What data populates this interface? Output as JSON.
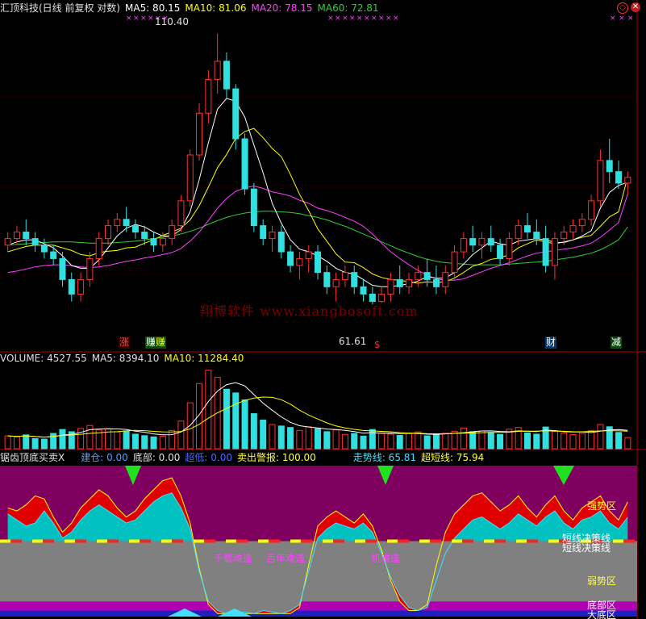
{
  "panel1": {
    "title": "汇顶科技(日线 前复权 对数)",
    "ma5_label": "MA5: 80.15",
    "ma10_label": "MA10: 81.06",
    "ma20_label": "MA20: 78.15",
    "ma60_label": "MA60: 72.81",
    "high_marker": "110.40",
    "low_marker": "61.61",
    "watermark": "翔博软件 www.xiangbosoft.com",
    "signals": [
      {
        "text": "涨",
        "color": "#ff4040",
        "bg": "#3a0000"
      },
      {
        "text": "赚",
        "color": "#ffffff",
        "bg": "#0a4a0a"
      },
      {
        "text": "赚",
        "color": "#ffff00",
        "bg": "#0a4a0a"
      },
      {
        "text": "$",
        "color": "#ff2020",
        "bg": "#000000"
      },
      {
        "text": "财",
        "color": "#ffffff",
        "bg": "#003a6a"
      },
      {
        "text": "减",
        "color": "#ffffff",
        "bg": "#0a4a0a"
      }
    ],
    "controls": [
      "◇",
      "✕"
    ]
  },
  "panel2": {
    "volume_label": "VOLUME: 4527.55",
    "ma5_label": "MA5: 8394.10",
    "ma10_label": "MA10: 11284.40"
  },
  "panel3": {
    "title": "锯齿顶底买卖X",
    "items": [
      {
        "label": "建仓: 0.00",
        "color": "#4aa0ff"
      },
      {
        "label": "底部: 0.00",
        "color": "#e0e0e0"
      },
      {
        "label": "超低: 0.00",
        "color": "#4a6aff"
      },
      {
        "label": "卖出警报: 100.00",
        "color": "#ffff40"
      },
      {
        "label": "走势线: 65.81",
        "color": "#40e0ff"
      },
      {
        "label": "超短线: 75.94",
        "color": "#ffff40"
      }
    ],
    "zone_labels": {
      "strong": "强势区",
      "decision1": "短线决策线",
      "decision2": "短线决策线",
      "weak": "弱势区",
      "bottom": "底部区",
      "big_bottom": "大底区"
    },
    "annotations": [
      "千载难逢",
      "百年难逢",
      "机难逢"
    ]
  },
  "colors": {
    "up": "#ff3030",
    "down": "#30e0e0",
    "ma5": "#ffffff",
    "ma10": "#ffff00",
    "ma20": "#ff40ff",
    "ma60": "#30d030",
    "strong_bg": "#800060",
    "weak_bg": "#808080",
    "trend": "#00c0c0"
  },
  "chart_data": {
    "type": "candlestick",
    "price_scale": "log",
    "ylim": [
      58,
      115
    ],
    "candles": [
      [
        70,
        72,
        69,
        71
      ],
      [
        71,
        73,
        70,
        72
      ],
      [
        72,
        74,
        70,
        71
      ],
      [
        71,
        72,
        69,
        70
      ],
      [
        70,
        71,
        68,
        69
      ],
      [
        69,
        70,
        67,
        68
      ],
      [
        68,
        69,
        64,
        65
      ],
      [
        65,
        66,
        62,
        63
      ],
      [
        63,
        66,
        62,
        65
      ],
      [
        65,
        69,
        64,
        68
      ],
      [
        68,
        72,
        67,
        71
      ],
      [
        71,
        74,
        70,
        73
      ],
      [
        73,
        75,
        72,
        74
      ],
      [
        74,
        76,
        72,
        73
      ],
      [
        73,
        74,
        71,
        72
      ],
      [
        72,
        73,
        70,
        71
      ],
      [
        71,
        72,
        69,
        70
      ],
      [
        70,
        72,
        69,
        71
      ],
      [
        71,
        74,
        70,
        73
      ],
      [
        73,
        78,
        72,
        77
      ],
      [
        77,
        86,
        76,
        85
      ],
      [
        85,
        95,
        84,
        93
      ],
      [
        93,
        102,
        91,
        100
      ],
      [
        100,
        110.4,
        97,
        104
      ],
      [
        104,
        106,
        96,
        98
      ],
      [
        98,
        99,
        86,
        88
      ],
      [
        88,
        89,
        78,
        79
      ],
      [
        79,
        80,
        72,
        73
      ],
      [
        73,
        74,
        70,
        71
      ],
      [
        71,
        73,
        69,
        72
      ],
      [
        72,
        73,
        68,
        69
      ],
      [
        69,
        70,
        66,
        67
      ],
      [
        67,
        69,
        65,
        68
      ],
      [
        68,
        70,
        66,
        69
      ],
      [
        69,
        70,
        65,
        66
      ],
      [
        66,
        67,
        63,
        64
      ],
      [
        64,
        66,
        62,
        65
      ],
      [
        65,
        67,
        64,
        66
      ],
      [
        66,
        67,
        63,
        64
      ],
      [
        64,
        65,
        62,
        63
      ],
      [
        63,
        64,
        61.61,
        62
      ],
      [
        62,
        64,
        61.8,
        63
      ],
      [
        63,
        66,
        62,
        65
      ],
      [
        65,
        67,
        63,
        64
      ],
      [
        64,
        66,
        63,
        65
      ],
      [
        65,
        67,
        64,
        66
      ],
      [
        66,
        68,
        64,
        65
      ],
      [
        65,
        67,
        63,
        64
      ],
      [
        64,
        67,
        63,
        66
      ],
      [
        66,
        70,
        65,
        69
      ],
      [
        69,
        72,
        68,
        71
      ],
      [
        71,
        73,
        69,
        70
      ],
      [
        70,
        72,
        68,
        71
      ],
      [
        71,
        73,
        69,
        70
      ],
      [
        70,
        71,
        67,
        68
      ],
      [
        68,
        72,
        67,
        71
      ],
      [
        71,
        74,
        70,
        73
      ],
      [
        73,
        75,
        71,
        72
      ],
      [
        72,
        74,
        70,
        71
      ],
      [
        71,
        73,
        66,
        67
      ],
      [
        67,
        72,
        65,
        71
      ],
      [
        71,
        73,
        70,
        72
      ],
      [
        72,
        74,
        71,
        73
      ],
      [
        73,
        75,
        72,
        74
      ],
      [
        74,
        78,
        73,
        77
      ],
      [
        77,
        86,
        76,
        84
      ],
      [
        84,
        88,
        80,
        82
      ],
      [
        82,
        84,
        79,
        80
      ],
      [
        80,
        82,
        78,
        81
      ]
    ],
    "ma5": [
      70,
      70.5,
      70.8,
      70.8,
      70.2,
      69.6,
      68.4,
      67,
      66.6,
      66.6,
      67.8,
      69.6,
      71.4,
      72.6,
      73.2,
      72.8,
      72,
      71.4,
      71.4,
      72.4,
      75.2,
      80.6,
      87.2,
      93.8,
      96,
      95.4,
      92.2,
      86.8,
      81.8,
      76.6,
      73.4,
      70.8,
      69.4,
      69,
      68.4,
      67.6,
      66.6,
      66,
      65.8,
      65,
      64.2,
      64,
      64,
      64.2,
      64.4,
      64.8,
      65.4,
      65.2,
      65.2,
      66,
      67.2,
      68.6,
      69.6,
      70.6,
      70.2,
      70,
      70.6,
      70.8,
      71,
      70.8,
      70.4,
      70.4,
      70.8,
      71.4,
      72.2,
      75.8,
      78.4,
      79.6,
      80.15
    ],
    "ma10": [
      69,
      69.4,
      69.8,
      70,
      70,
      70,
      69.6,
      69.2,
      68.6,
      68.4,
      68.9,
      69.1,
      69.2,
      69.6,
      69.7,
      70.3,
      70.8,
      71.5,
      72,
      72.6,
      73.9,
      76.2,
      79.3,
      82.7,
      85.1,
      88.1,
      89.4,
      90,
      88.2,
      86.2,
      84.7,
      81.5,
      78.1,
      75.4,
      72.5,
      70.6,
      68.7,
      67.5,
      67.4,
      66.7,
      65.8,
      65.3,
      65,
      64.9,
      64.7,
      64.5,
      64.7,
      64.6,
      64.7,
      65.2,
      66,
      66.9,
      67.3,
      67.9,
      68.1,
      68.6,
      69.6,
      70.2,
      70.8,
      70.5,
      70.2,
      70.5,
      70.8,
      71.2,
      71.5,
      72.9,
      74.4,
      75.2,
      81.06
    ],
    "ma20": [
      66,
      66.2,
      66.5,
      66.8,
      67,
      67.1,
      67.1,
      67,
      66.8,
      66.7,
      66.8,
      67,
      67.3,
      67.6,
      67.8,
      68.1,
      68.3,
      68.6,
      68.9,
      69.5,
      70.6,
      72,
      73.8,
      75.8,
      77.4,
      78.6,
      79.2,
      79.5,
      79.1,
      78.5,
      78.2,
      77.8,
      77.1,
      76.6,
      75.8,
      75.4,
      74.9,
      74.3,
      73.7,
      72.9,
      71.7,
      70.3,
      69,
      68,
      67.1,
      66.3,
      65.6,
      65.1,
      64.9,
      64.9,
      65.1,
      65.6,
      66.1,
      66.6,
      67,
      67.4,
      67.9,
      68.4,
      68.8,
      69,
      69.2,
      69.4,
      69.6,
      69.9,
      70.3,
      71.2,
      72.3,
      73.5,
      78.15
    ],
    "ma60": [
      70,
      70.1,
      70.2,
      70.3,
      70.4,
      70.5,
      70.5,
      70.5,
      70.4,
      70.3,
      70.3,
      70.3,
      70.4,
      70.5,
      70.6,
      70.8,
      71,
      71.2,
      71.4,
      71.7,
      72.1,
      72.6,
      73.2,
      73.8,
      74.3,
      74.7,
      75,
      75.2,
      75.3,
      75.3,
      75.2,
      75.1,
      74.9,
      74.6,
      74.3,
      73.9,
      73.4,
      72.9,
      72.3,
      71.7,
      71.1,
      70.5,
      69.9,
      69.3,
      68.8,
      68.3,
      67.9,
      67.6,
      67.4,
      67.3,
      67.2,
      67.1,
      67.1,
      67.1,
      67.1,
      67.2,
      67.3,
      67.4,
      67.5,
      67.6,
      67.8,
      68,
      68.2,
      68.5,
      68.8,
      69.3,
      70,
      70.8,
      72.81
    ],
    "volume": [
      5200,
      4800,
      5600,
      4100,
      3900,
      6200,
      7800,
      6900,
      8200,
      9400,
      7600,
      8100,
      6800,
      7200,
      5900,
      5300,
      4800,
      5100,
      7400,
      11200,
      18600,
      26400,
      31800,
      28900,
      24100,
      22600,
      19800,
      14200,
      11600,
      9800,
      9200,
      8600,
      7400,
      8900,
      8100,
      6900,
      7600,
      5800,
      6200,
      5100,
      7800,
      6400,
      5900,
      5400,
      6100,
      6800,
      5200,
      5600,
      6300,
      7100,
      8400,
      6900,
      7200,
      6600,
      5800,
      7900,
      8600,
      6400,
      5900,
      8800,
      7100,
      6300,
      5700,
      6200,
      7400,
      9800,
      8900,
      6600,
      4527.55
    ],
    "vol_ma5": 8394.1,
    "vol_ma10": 11284.4,
    "indicator": {
      "ylim": [
        0,
        100
      ],
      "trend_line": [
        68,
        64,
        60,
        62,
        70,
        62,
        52,
        56,
        64,
        70,
        74,
        70,
        66,
        62,
        64,
        70,
        76,
        80,
        82,
        72,
        58,
        30,
        10,
        4,
        2,
        2,
        3,
        2,
        4,
        3,
        2,
        4,
        8,
        30,
        52,
        58,
        62,
        60,
        58,
        62,
        56,
        42,
        26,
        14,
        6,
        4,
        6,
        24,
        42,
        52,
        58,
        64,
        66,
        62,
        58,
        62,
        68,
        64,
        60,
        66,
        70,
        62,
        58,
        64,
        66,
        70,
        62,
        58,
        65.81
      ],
      "short_line": [
        72,
        70,
        74,
        80,
        78,
        66,
        56,
        62,
        72,
        78,
        84,
        80,
        72,
        66,
        70,
        78,
        84,
        90,
        92,
        80,
        62,
        32,
        8,
        2,
        2,
        2,
        2,
        2,
        2,
        2,
        2,
        2,
        6,
        34,
        60,
        66,
        70,
        66,
        62,
        68,
        60,
        44,
        24,
        10,
        4,
        4,
        8,
        34,
        56,
        68,
        74,
        80,
        82,
        76,
        70,
        74,
        80,
        72,
        66,
        74,
        80,
        70,
        64,
        72,
        76,
        80,
        70,
        64,
        75.94
      ],
      "jiancang": 0.0,
      "dibu": 0.0,
      "chaodi": 0.0,
      "sell_alert": 100.0
    }
  }
}
